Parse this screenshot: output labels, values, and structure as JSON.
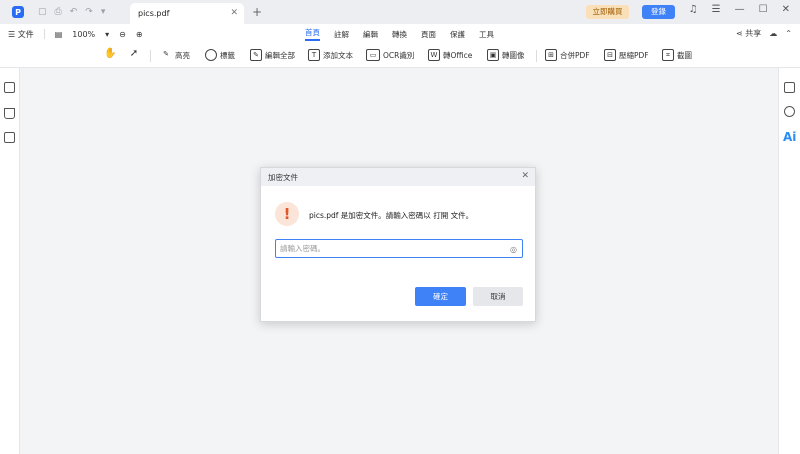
{
  "titlebar": {
    "tab_title": "pics.pdf",
    "buy_label": "立即購買",
    "login_label": "登錄"
  },
  "menubar": {
    "file_label": "文件",
    "zoom_value": "100%",
    "tabs": [
      "首頁",
      "註解",
      "編輯",
      "轉換",
      "頁面",
      "保護",
      "工具"
    ],
    "share_label": "共享"
  },
  "toolbar": {
    "highlight": "高亮",
    "label": "標籤",
    "edit_all": "編輯全部",
    "add_text": "添加文本",
    "ocr": "OCR識別",
    "to_office": "轉Office",
    "to_image": "轉圖像",
    "merge_pdf": "合併PDF",
    "compress_pdf": "壓縮PDF",
    "screenshot": "截圖"
  },
  "dialog": {
    "title": "加密文件",
    "message": "pics.pdf 是加密文件。請輸入密碼以 打開 文件。",
    "password_placeholder": "請輸入密碼。",
    "ok_label": "確定",
    "cancel_label": "取消"
  },
  "colors": {
    "accent": "#3f82f7",
    "warning": "#e2572a",
    "buy": "#f9e0b8"
  }
}
